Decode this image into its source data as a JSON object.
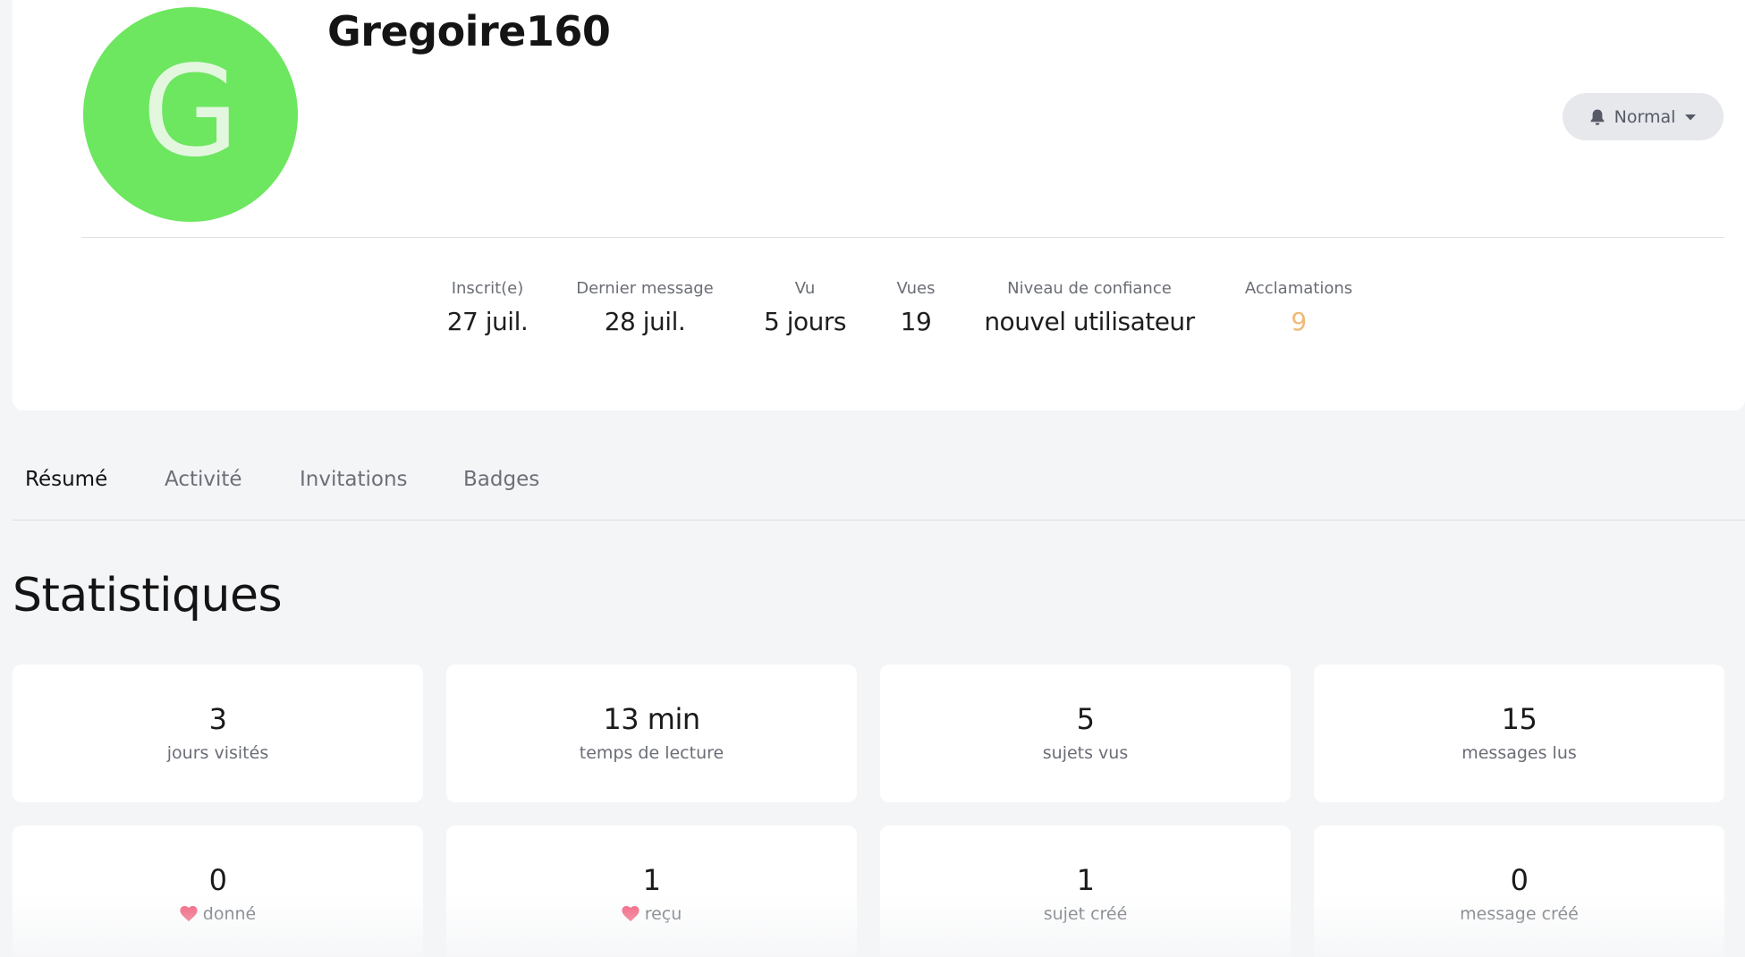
{
  "profile": {
    "avatar_letter": "G",
    "username": "Gregoire160",
    "notification_level": "Normal"
  },
  "summary": {
    "registered": {
      "label": "Inscrit(e)",
      "value": "27 juil."
    },
    "last_post": {
      "label": "Dernier message",
      "value": "28 juil."
    },
    "seen": {
      "label": "Vu",
      "value": "5 jours"
    },
    "views": {
      "label": "Vues",
      "value": "19"
    },
    "trust_level": {
      "label": "Niveau de confiance",
      "value": "nouvel utilisateur"
    },
    "cheers": {
      "label": "Acclamations",
      "value": "9"
    }
  },
  "tabs": [
    {
      "label": "Résumé",
      "active": true
    },
    {
      "label": "Activité",
      "active": false
    },
    {
      "label": "Invitations",
      "active": false
    },
    {
      "label": "Badges",
      "active": false
    }
  ],
  "stats_section": {
    "title": "Statistiques",
    "cards": [
      {
        "value": "3",
        "label": "jours visités"
      },
      {
        "value": "13 min",
        "label": "temps de lecture"
      },
      {
        "value": "5",
        "label": "sujets vus"
      },
      {
        "value": "15",
        "label": "messages lus"
      },
      {
        "value": "0",
        "label": "donné",
        "icon": "heart-icon"
      },
      {
        "value": "1",
        "label": "reçu",
        "icon": "heart-icon"
      },
      {
        "value": "1",
        "label": "sujet créé"
      },
      {
        "value": "0",
        "label": "message créé"
      }
    ]
  },
  "colors": {
    "avatar_bg": "#6de660",
    "cheers": "#f0b978",
    "heart": "#f25a78"
  }
}
